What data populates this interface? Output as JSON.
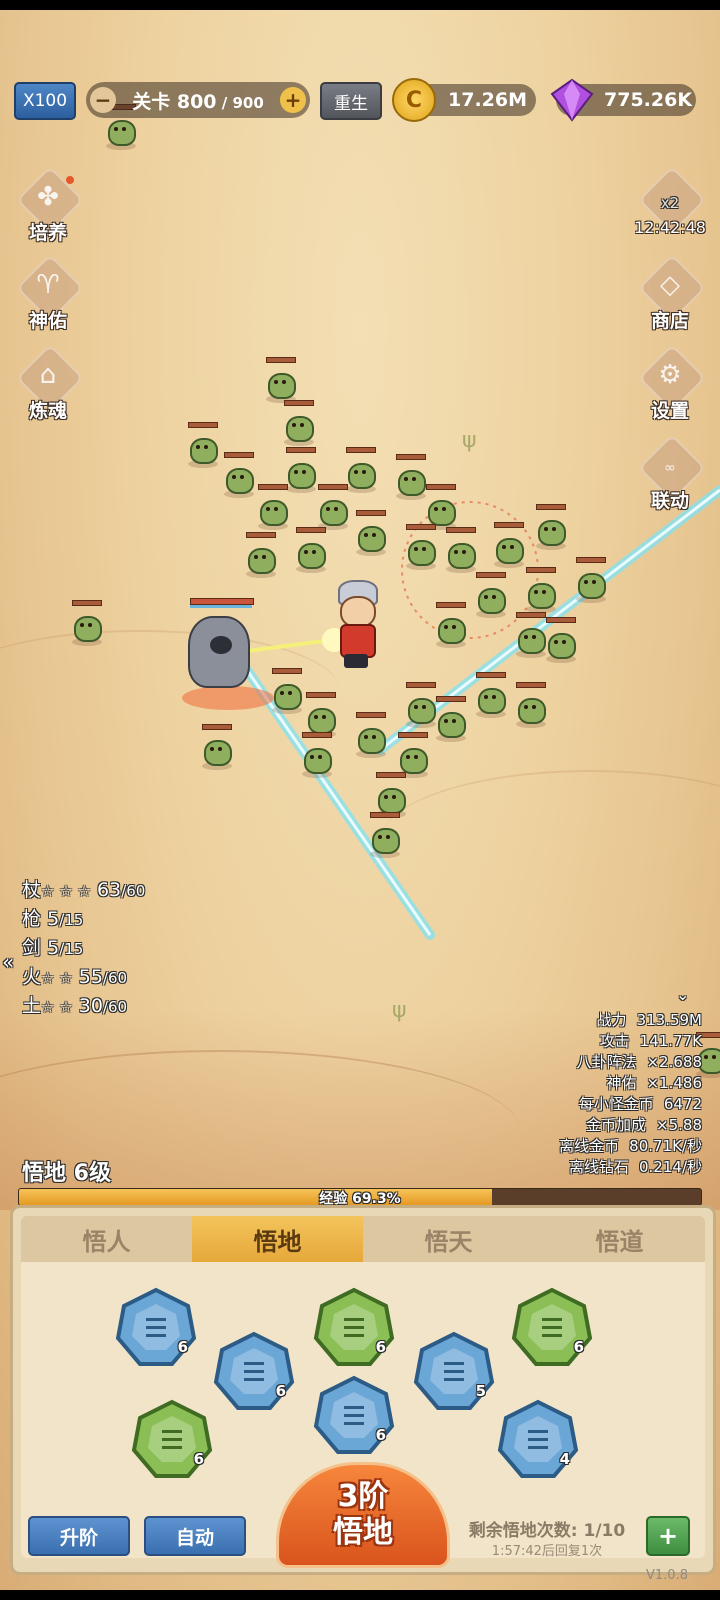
{
  "top_bar": {
    "speed_label": "X100",
    "level_prefix": "关卡",
    "level_current": "800",
    "level_separator": " / ",
    "level_total": "900",
    "minus_label": "−",
    "plus_label": "+",
    "rebirth_label": "重生",
    "coins": "17.26M",
    "coin_symbol": "C",
    "gems": "775.26K"
  },
  "left_menu": [
    {
      "label": "培养",
      "icon": "cultivate-icon"
    },
    {
      "label": "神佑",
      "icon": "blessing-icon"
    },
    {
      "label": "炼魂",
      "icon": "soul-refine-icon"
    }
  ],
  "right_menu": {
    "boost_label": "x2",
    "boost_timer": "12:42:48",
    "shop_label": "商店",
    "settings_label": "设置",
    "link_label": "联动"
  },
  "weapons": [
    {
      "name": "杖",
      "stars": "☆ ☆ ☆",
      "value": "63",
      "max": "/60"
    },
    {
      "name": "枪",
      "stars": "",
      "value": "5",
      "max": "/15"
    },
    {
      "name": "剑",
      "stars": "",
      "value": "5",
      "max": "/15"
    },
    {
      "name": "火",
      "stars": "☆ ☆",
      "value": "55",
      "max": "/60"
    },
    {
      "name": "土",
      "stars": "☆ ☆",
      "value": "30",
      "max": "/60"
    }
  ],
  "collapse_arrow": "«",
  "expand_arrow": "⌄",
  "stats": [
    {
      "label": "战力",
      "value": "313.59M"
    },
    {
      "label": "攻击",
      "value": "141.77K"
    },
    {
      "label": "八卦阵法",
      "value": "×2.688"
    },
    {
      "label": "神佑",
      "value": "×1.486"
    },
    {
      "label": "每小怪金币",
      "value": "6472"
    },
    {
      "label": "金币加成",
      "value": "×5.88"
    },
    {
      "label": "离线金币",
      "value": "80.71K/秒"
    },
    {
      "label": "离线钻石",
      "value": "0.214/秒"
    }
  ],
  "realm": {
    "title": "悟地 6级",
    "exp_label": "经验 69.3%",
    "exp_fraction": 0.693
  },
  "tabs": [
    "悟人",
    "悟地",
    "悟天",
    "悟道"
  ],
  "active_tab": 1,
  "gems": [
    {
      "count": "6",
      "color": "blue"
    },
    {
      "count": "6",
      "color": "blue"
    },
    {
      "count": "6",
      "color": "green"
    },
    {
      "count": "6",
      "color": "blue"
    },
    {
      "count": "5",
      "color": "blue"
    },
    {
      "count": "6",
      "color": "green"
    },
    {
      "count": "6",
      "color": "green"
    },
    {
      "count": "4",
      "color": "blue"
    }
  ],
  "gem_colors": {
    "blue": "#6aa6d6",
    "green": "#8bbf56"
  },
  "actions": {
    "upgrade_label": "升阶",
    "auto_label": "自动",
    "main_line1": "3阶",
    "main_line2": "悟地",
    "remaining_label": "剩余悟地次数: 1/10",
    "recover_label": "1:57:42后回复1次",
    "add_label": "+"
  },
  "version": "V1.0.8"
}
